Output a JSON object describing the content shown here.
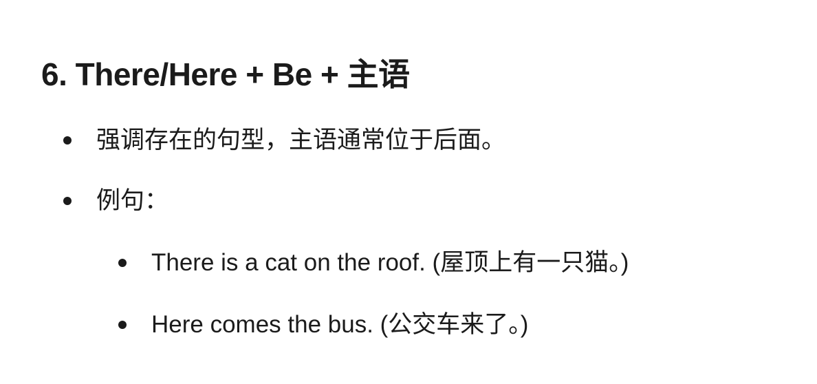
{
  "heading": "6. There/Here + Be + 主语",
  "bullets": [
    "强调存在的句型，主语通常位于后面。",
    "例句："
  ],
  "examples": [
    "There is a cat on the roof. (屋顶上有一只猫。)",
    "Here comes the bus. (公交车来了。)"
  ],
  "colors": {
    "text": "#1b1b1b",
    "background": "#ffffff"
  }
}
